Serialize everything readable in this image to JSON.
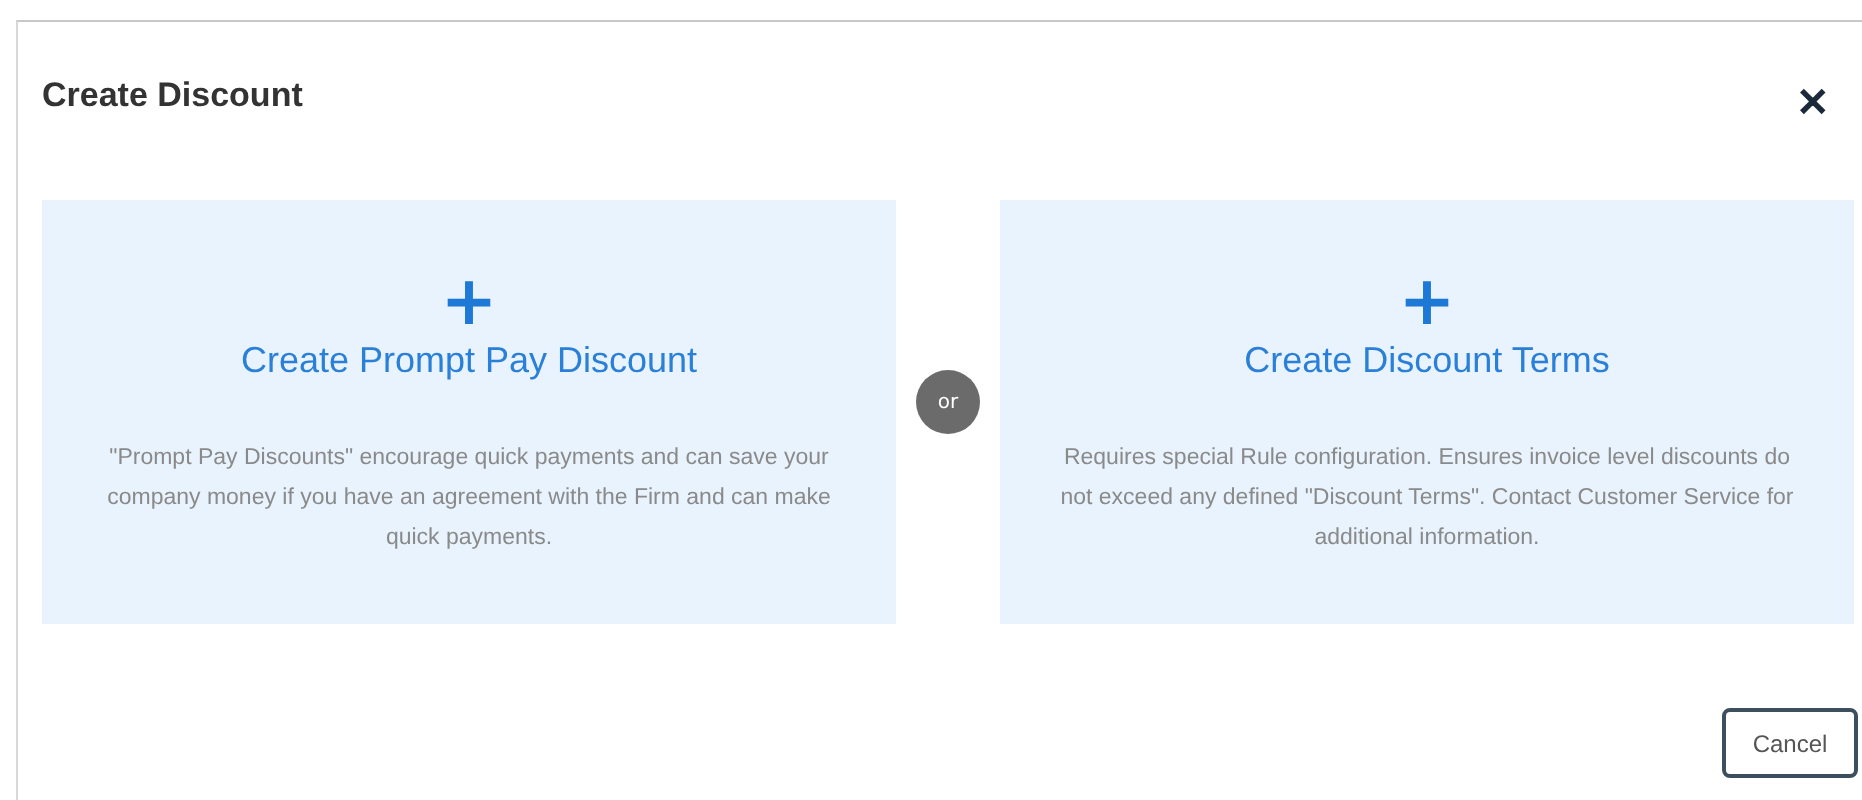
{
  "dialog": {
    "title": "Create Discount",
    "close": "✕"
  },
  "options": [
    {
      "icon": "+",
      "title": "Create Prompt Pay Discount",
      "description": "\"Prompt Pay Discounts\" encourage quick payments and can save your company money if you have an agreement with the Firm and can make quick payments."
    },
    {
      "icon": "+",
      "title": "Create Discount Terms",
      "description": "Requires special Rule configuration. Ensures invoice level discounts do not exceed any defined \"Discount Terms\". Contact Customer Service for additional information."
    }
  ],
  "separator": "or",
  "buttons": [
    {
      "label": "Cancel"
    }
  ]
}
